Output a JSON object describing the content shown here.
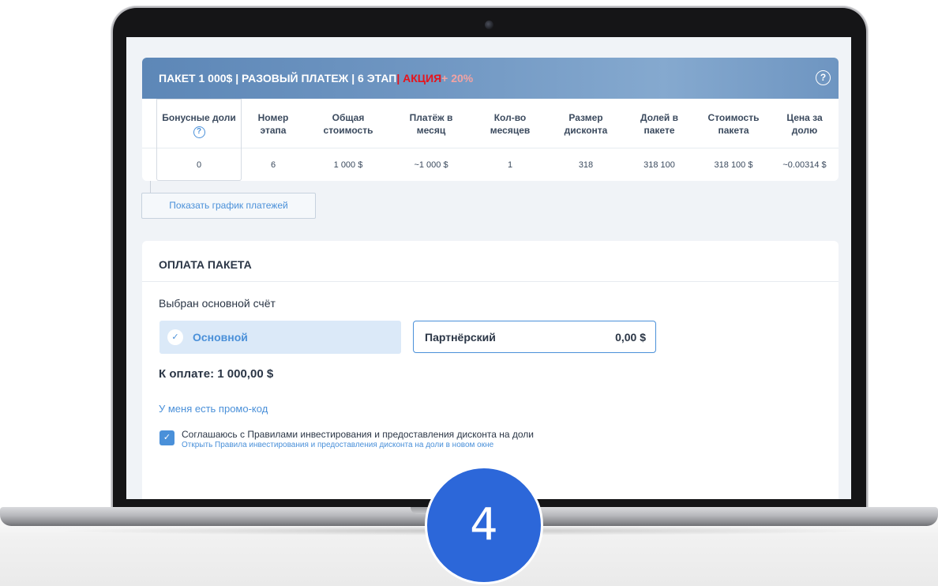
{
  "header": {
    "title_main": "ПАКЕТ 1 000$ | РАЗОВЫЙ ПЛАТЕЖ | 6 ЭТАП",
    "title_promo": "| АКЦИЯ",
    "title_bonus": " + 20%",
    "help_glyph": "?"
  },
  "table": {
    "columns": [
      {
        "line1": "Бонусные доли",
        "line2": "?",
        "value": "0"
      },
      {
        "line1": "Номер",
        "line2": "этапа",
        "value": "6"
      },
      {
        "line1": "Общая",
        "line2": "стоимость",
        "value": "1 000 $"
      },
      {
        "line1": "Платёж в",
        "line2": "месяц",
        "value": "~1 000 $"
      },
      {
        "line1": "Кол-во",
        "line2": "месяцев",
        "value": "1"
      },
      {
        "line1": "Размер",
        "line2": "дисконта",
        "value": "318"
      },
      {
        "line1": "Долей в",
        "line2": "пакете",
        "value": "318 100"
      },
      {
        "line1": "Стоимость",
        "line2": "пакета",
        "value": "318 100 $"
      },
      {
        "line1": "Цена за",
        "line2": "долю",
        "value": "~0.00314 $"
      }
    ]
  },
  "schedule_button": "Показать график платежей",
  "payment": {
    "title": "ОПЛАТА ПАКЕТА",
    "selected_label": "Выбран основной счёт",
    "main_account": "Основной",
    "partner_account": "Партнёрский",
    "partner_balance": "0,00 $",
    "total": "К оплате: 1 000,00 $",
    "promo_link": "У меня есть промо-код",
    "agree_text": "Соглашаюсь с Правилами инвестирования и предоставления дисконта на доли",
    "rules_link": "Открыть Правила инвестирования и предоставления дисконта на доли в новом окне",
    "check_glyph": "✓"
  },
  "step_badge": "4",
  "colors": {
    "header_blue": "#6f96c2",
    "promo_red": "#e8121a",
    "link_blue": "#4a90d9",
    "badge_blue": "#2c67d9"
  }
}
